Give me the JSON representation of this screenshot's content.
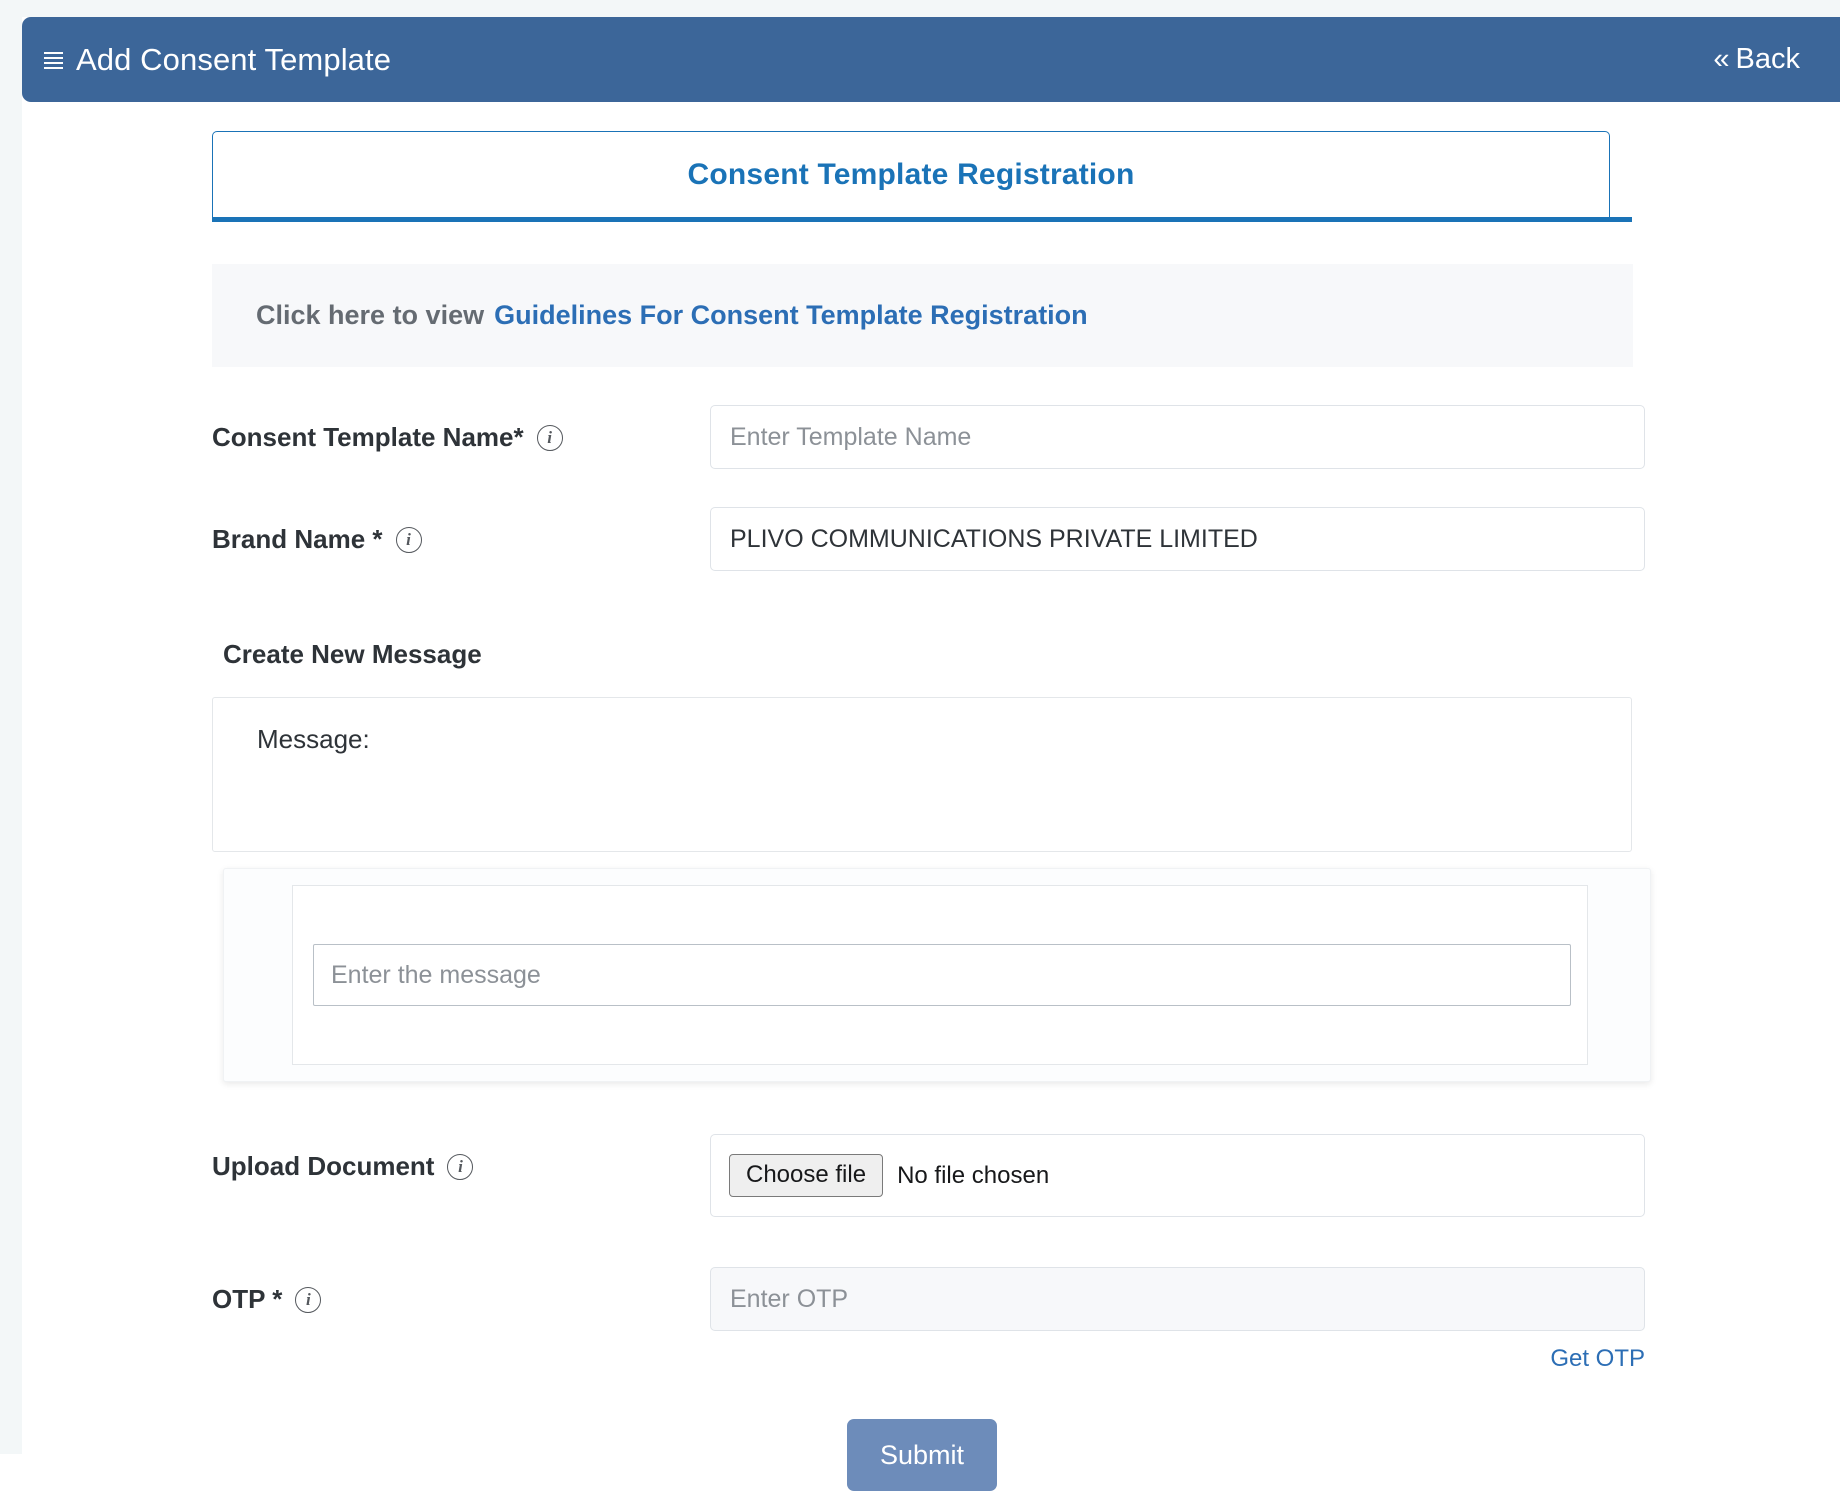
{
  "appbar": {
    "menu_icon": "hamburger-menu-icon",
    "title": "Add Consent Template",
    "back_label": "Back",
    "back_chevron": "«",
    "background_color": "#3c6699"
  },
  "tab_card": {
    "title": "Consent Template Registration",
    "accent_color": "#1a73b7"
  },
  "guidelines": {
    "static_text": "Click here to view",
    "link_text": "Guidelines For Consent Template Registration",
    "link_color": "#2c6eb5"
  },
  "fields": {
    "template_name": {
      "label": "Consent Template Name*",
      "info_icon": "info-icon",
      "placeholder": "Enter Template Name",
      "value": ""
    },
    "brand_name": {
      "label": "Brand Name *",
      "info_icon": "info-icon",
      "placeholder": "",
      "value": "PLIVO COMMUNICATIONS PRIVATE LIMITED"
    },
    "upload_document": {
      "label": "Upload Document",
      "info_icon": "info-icon",
      "button_label": "Choose file",
      "status_text": "No file chosen"
    },
    "otp": {
      "label": "OTP *",
      "info_icon": "info-icon",
      "placeholder": "Enter OTP",
      "value": "",
      "get_otp_label": "Get OTP"
    }
  },
  "message_section": {
    "title": "Create New Message",
    "preview_label": "Message:",
    "preview_text": "",
    "input_placeholder": "Enter the message",
    "input_value": ""
  },
  "submit": {
    "label": "Submit",
    "color": "#6d8cba"
  }
}
